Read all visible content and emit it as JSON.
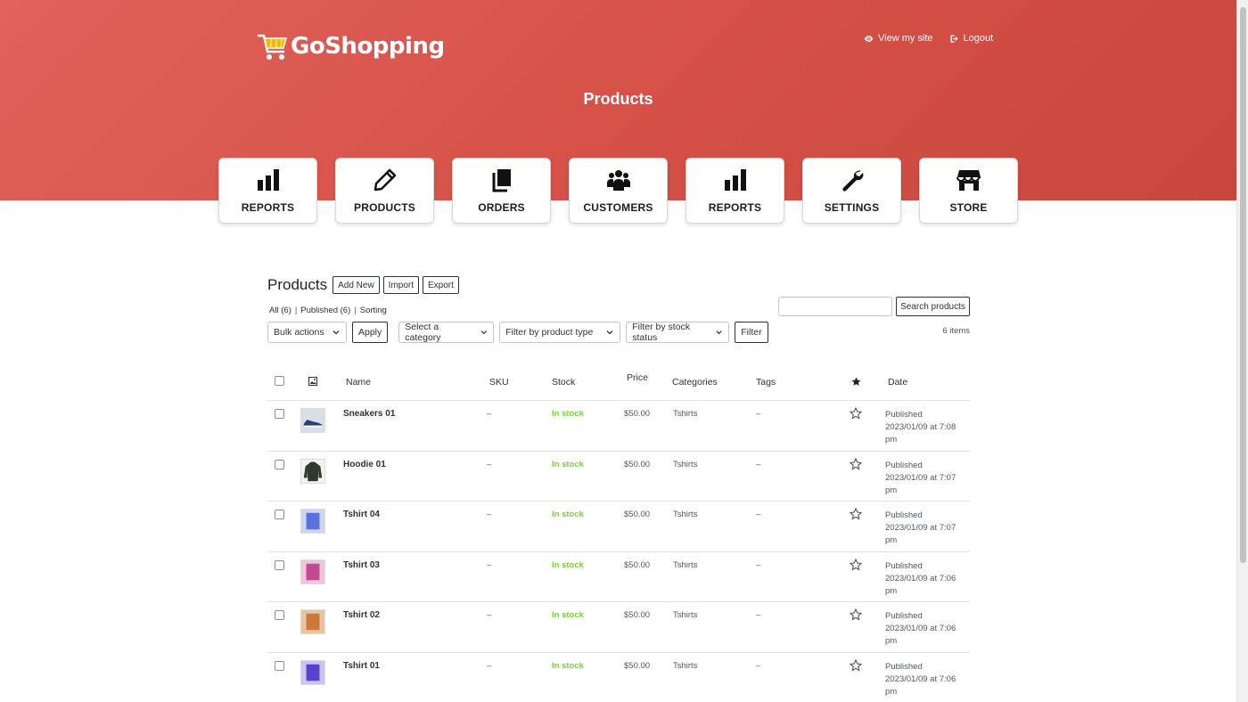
{
  "brand": {
    "name": "GoShopping",
    "cart_color": "#f5b800"
  },
  "top_links": {
    "view_site": "View my site",
    "logout": "Logout"
  },
  "hero": {
    "title": "Products",
    "color": "#d65248"
  },
  "nav": [
    {
      "label": "REPORTS",
      "icon": "bar-chart-icon"
    },
    {
      "label": "PRODUCTS",
      "icon": "pencil-icon"
    },
    {
      "label": "ORDERS",
      "icon": "copy-icon"
    },
    {
      "label": "CUSTOMERS",
      "icon": "users-icon"
    },
    {
      "label": "REPORTS",
      "icon": "bar-chart-icon"
    },
    {
      "label": "SETTINGS",
      "icon": "wrench-icon"
    },
    {
      "label": "STORE",
      "icon": "store-icon"
    }
  ],
  "page": {
    "heading": "Products",
    "add_new": "Add New",
    "import": "Import",
    "export": "Export",
    "views": {
      "all": "All (6)",
      "published": "Published (6)",
      "sorting": "Sorting"
    },
    "search_button": "Search products",
    "items_count": "6 items"
  },
  "filters": {
    "bulk_actions": "Bulk actions",
    "apply": "Apply",
    "category": "Select a category",
    "product_type": "Filter by product type",
    "stock_status": "Filter by stock status",
    "filter": "Filter"
  },
  "table": {
    "headers": {
      "name": "Name",
      "sku": "SKU",
      "stock": "Stock",
      "price": "Price",
      "categories": "Categories",
      "tags": "Tags",
      "date": "Date"
    },
    "rows": [
      {
        "name": "Sneakers 01",
        "sku": "–",
        "stock": "In stock",
        "price": "$50.00",
        "categories": "Tshirts",
        "tags": "–",
        "status": "Published",
        "date": "2023/01/09 at 7:08",
        "ampm": "pm",
        "thumb_color": "#d8dfe8"
      },
      {
        "name": "Hoodie 01",
        "sku": "–",
        "stock": "In stock",
        "price": "$50.00",
        "categories": "Tshirts",
        "tags": "–",
        "status": "Published",
        "date": "2023/01/09 at 7:07",
        "ampm": "pm",
        "thumb_color": "#2f3a2c"
      },
      {
        "name": "Tshirt 04",
        "sku": "–",
        "stock": "In stock",
        "price": "$50.00",
        "categories": "Tshirts",
        "tags": "–",
        "status": "Published",
        "date": "2023/01/09 at 7:07",
        "ampm": "pm",
        "thumb_color": "#5a6fe0"
      },
      {
        "name": "Tshirt 03",
        "sku": "–",
        "stock": "In stock",
        "price": "$50.00",
        "categories": "Tshirts",
        "tags": "–",
        "status": "Published",
        "date": "2023/01/09 at 7:06",
        "ampm": "pm",
        "thumb_color": "#c24b8d"
      },
      {
        "name": "Tshirt 02",
        "sku": "–",
        "stock": "In stock",
        "price": "$50.00",
        "categories": "Tshirts",
        "tags": "–",
        "status": "Published",
        "date": "2023/01/09 at 7:06",
        "ampm": "pm",
        "thumb_color": "#c97a3a"
      },
      {
        "name": "Tshirt 01",
        "sku": "–",
        "stock": "In stock",
        "price": "$50.00",
        "categories": "Tshirts",
        "tags": "–",
        "status": "Published",
        "date": "2023/01/09 at 7:06",
        "ampm": "pm",
        "thumb_color": "#5a42d0"
      }
    ]
  }
}
